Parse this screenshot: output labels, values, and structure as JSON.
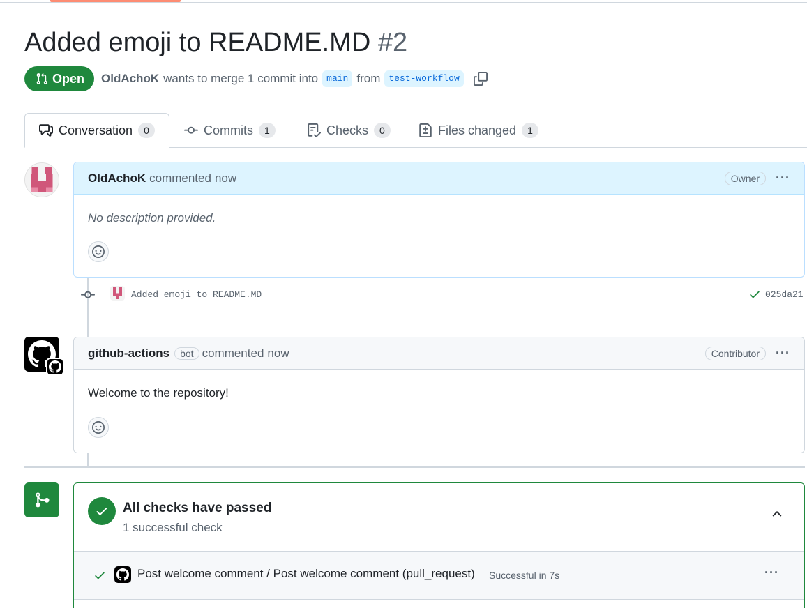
{
  "pr": {
    "title": "Added emoji to README.MD",
    "number": "#2",
    "state": "Open",
    "author": "OldAchoK",
    "merge_text": "wants to merge 1 commit into",
    "base_branch": "main",
    "from_text": "from",
    "head_branch": "test-workflow"
  },
  "tabs": [
    {
      "label": "Conversation",
      "count": "0"
    },
    {
      "label": "Commits",
      "count": "1"
    },
    {
      "label": "Checks",
      "count": "0"
    },
    {
      "label": "Files changed",
      "count": "1"
    }
  ],
  "comment1": {
    "author": "OldAchoK",
    "action": "commented",
    "time": "now",
    "role": "Owner",
    "body": "No description provided."
  },
  "commit": {
    "message": "Added emoji to README.MD",
    "sha": "025da21"
  },
  "comment2": {
    "author": "github-actions",
    "bot_label": "bot",
    "action": "commented",
    "time": "now",
    "role": "Contributor",
    "body": "Welcome to the repository!"
  },
  "checks": {
    "title": "All checks have passed",
    "subtitle": "1 successful check",
    "item_name": "Post welcome comment / Post welcome comment (pull_request)",
    "item_status": "Successful in 7s"
  },
  "colors": {
    "success": "#1f883d",
    "accent": "#0969da",
    "tab_underline": "#fd8c73"
  }
}
